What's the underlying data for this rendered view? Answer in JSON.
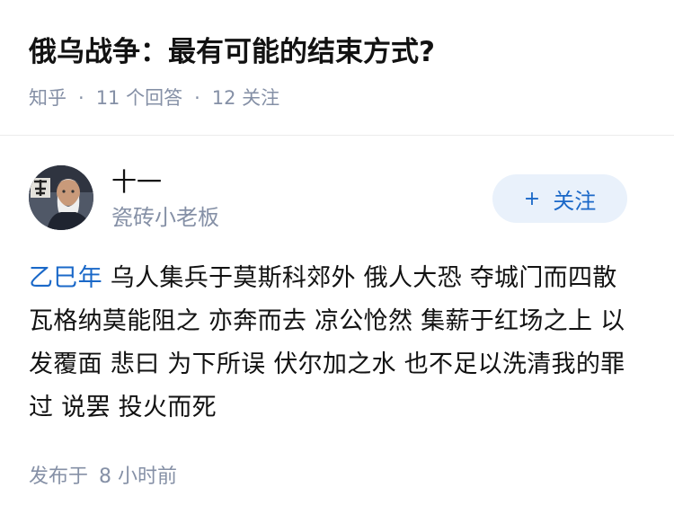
{
  "question": {
    "title": "俄乌战争：最有可能的结束方式?",
    "meta": {
      "source": "知乎",
      "separator": "·",
      "answers": "11 个回答",
      "followers": "12 关注"
    }
  },
  "author": {
    "name": "十一",
    "bio": "瓷砖小老板",
    "avatar_icon": "portrait-avatar",
    "follow_button": {
      "plus": "+",
      "label": "关注"
    }
  },
  "answer": {
    "lead_link": "乙巳年",
    "text": " 乌人集兵于莫斯科郊外 俄人大恐 夺城门而四散 瓦格纳莫能阻之 亦奔而去 凉公怆然 集薪于红场之上 以发覆面 悲曰 为下所误 伏尔加之水 也不足以洗清我的罪过 说罢 投火而死"
  },
  "footer": {
    "published_label": "发布于",
    "published_time": "8 小时前"
  },
  "colors": {
    "link_blue": "#1a68c8",
    "meta_gray": "#8590a6",
    "follow_bg": "#e9f1fb"
  }
}
